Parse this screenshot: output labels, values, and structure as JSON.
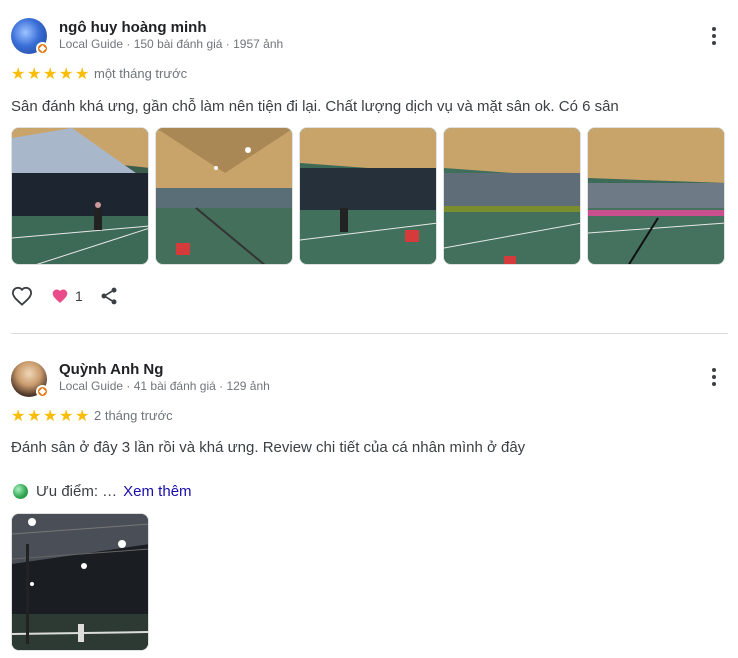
{
  "reviews": [
    {
      "author": "ngô huy hoàng minh",
      "meta": "Local Guide · 150 bài đánh giá · 1957 ảnh",
      "rating": 5,
      "date": "một tháng trước",
      "text": "Sân đánh khá ưng, gần chỗ làm nên tiện đi lại. Chất lượng dịch vụ và mặt sân ok. Có 6 sân",
      "photo_count": 5,
      "likes": "1",
      "icons": {
        "more": "more-vert-icon",
        "like": "heart-outline-icon",
        "reaction": "heart-filled-icon",
        "share": "share-icon",
        "badge": "local-guide-badge-icon"
      }
    },
    {
      "author": "Quỳnh Anh Ng",
      "meta": "Local Guide · 41 bài đánh giá · 129 ảnh",
      "rating": 5,
      "date": "2 tháng trước",
      "text": "Đánh sân ở đây 3 lần rồi và khá ưng. Review chi tiết của cá nhân mình ở đây",
      "pros_label": "Ưu điểm: …",
      "see_more": "Xem thêm",
      "photo_count": 1,
      "icons": {
        "more": "more-vert-icon",
        "pros": "green-circle-emoji-icon",
        "badge": "local-guide-badge-icon"
      }
    }
  ],
  "colors": {
    "star": "#fbbc04",
    "heart": "#ea4c89",
    "link": "#1a0dab",
    "muted": "#70757a",
    "badge": "#e8710a"
  }
}
